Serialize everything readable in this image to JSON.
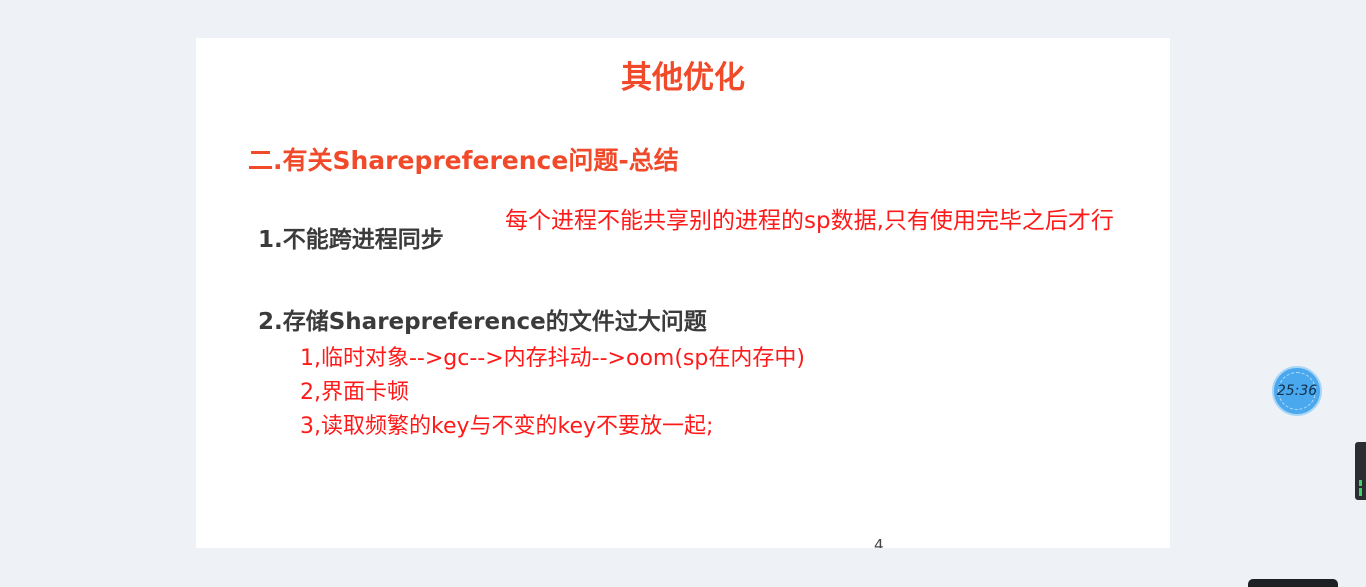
{
  "slide": {
    "title": "其他优化",
    "section_heading": "二.有关Sharepreference问题-总结",
    "point_1": "1.不能跨进程同步",
    "point_2": "2.存储Sharepreference的文件过大问题",
    "annotation_main": "每个进程不能共享别的进程的sp数据,只有使用完毕之后才行",
    "notes": [
      "1,临时对象-->gc-->内存抖动-->oom(sp在内存中)",
      "2,界面卡顿",
      "3,读取频繁的key与不变的key不要放一起;"
    ],
    "page_number": "4"
  },
  "timer": {
    "value": "25:36"
  },
  "colors": {
    "accent": "#f04a2a",
    "annotation": "#ff1a1a",
    "background": "#eef1f5",
    "timer": "#4aa8ee"
  }
}
